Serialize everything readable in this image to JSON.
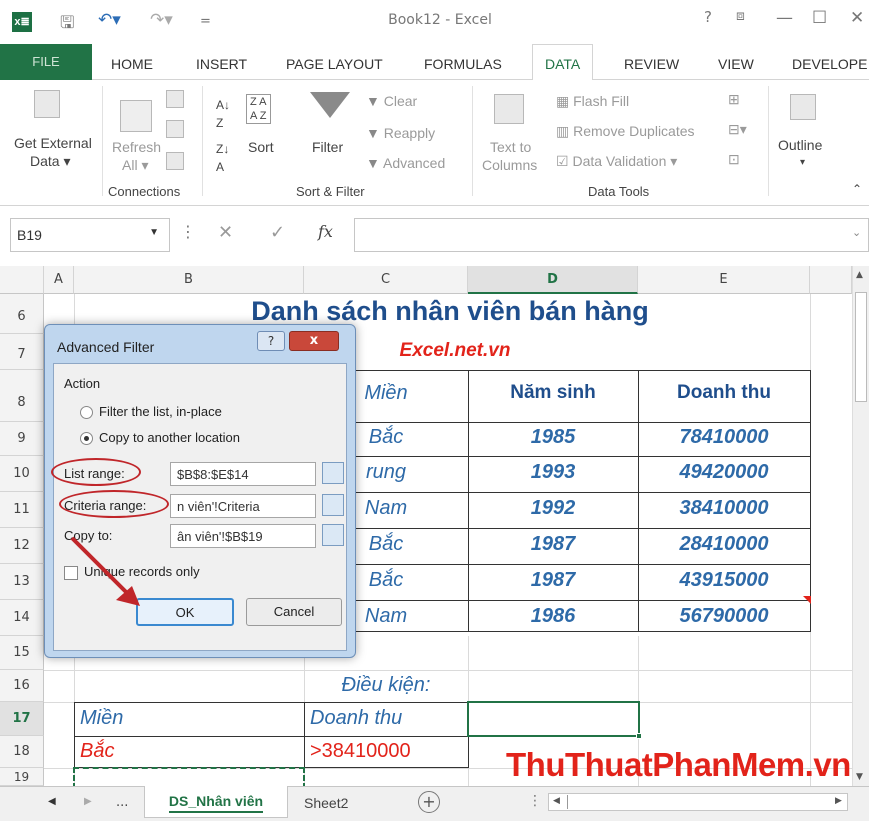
{
  "window": {
    "title": "Book12 - Excel"
  },
  "tabs": [
    "FILE",
    "HOME",
    "INSERT",
    "PAGE LAYOUT",
    "FORMULAS",
    "DATA",
    "REVIEW",
    "VIEW",
    "DEVELOPE"
  ],
  "ribbon": {
    "get_external_1": "Get External",
    "get_external_2": "Data",
    "refresh_1": "Refresh",
    "refresh_2": "All",
    "connections_label": "Connections",
    "filter": "Filter",
    "sort": "Sort",
    "clear": "Clear",
    "reapply": "Reapply",
    "advanced": "Advanced",
    "sort_filter_label": "Sort & Filter",
    "text_to_1": "Text to",
    "text_to_2": "Columns",
    "flash_fill": "Flash Fill",
    "remove_duplicates": "Remove Duplicates",
    "data_validation": "Data Validation",
    "data_tools_label": "Data Tools",
    "outline": "Outline"
  },
  "formula_bar": {
    "name_box": "B19",
    "fx": "fx",
    "value": ""
  },
  "columns": [
    "A",
    "B",
    "C",
    "D",
    "E"
  ],
  "rows": [
    "6",
    "7",
    "8",
    "9",
    "10",
    "11",
    "12",
    "13",
    "14",
    "15",
    "16",
    "17",
    "18",
    "19"
  ],
  "sheet": {
    "title": "Danh sách nhân viên bán hàng",
    "subtitle": "Excel.net.vn",
    "headers": {
      "c": "Miền",
      "d": "Năm sinh",
      "e": "Doanh thu"
    },
    "data": [
      {
        "c": "Bắc",
        "d": "1985",
        "e": "78410000"
      },
      {
        "c": "rung",
        "d": "1993",
        "e": "49420000"
      },
      {
        "c": "Nam",
        "d": "1992",
        "e": "38410000"
      },
      {
        "c": "Bắc",
        "d": "1987",
        "e": "28410000"
      },
      {
        "c": "Bắc",
        "d": "1987",
        "e": "43915000"
      },
      {
        "c": "Nam",
        "d": "1986",
        "e": "56790000"
      }
    ],
    "criteria_title": "Điều kiện:",
    "criteria_headers": {
      "b": "Miền",
      "c": "Doanh thu"
    },
    "criteria_values": {
      "b": "Bắc",
      "c": ">38410000"
    }
  },
  "dialog": {
    "title": "Advanced Filter",
    "help": "?",
    "close": "x",
    "action_label": "Action",
    "opt_inplace": "Filter the list, in-place",
    "opt_copy": "Copy to another location",
    "list_range_label": "List range:",
    "list_range_value": "$B$8:$E$14",
    "criteria_range_label": "Criteria range:",
    "criteria_range_value": "n viên'!Criteria",
    "copy_to_label": "Copy to:",
    "copy_to_value": "ân viên'!$B$19",
    "unique_label": "Unique records only",
    "ok": "OK",
    "cancel": "Cancel"
  },
  "sheet_tabs": {
    "ellipsis": "...",
    "active": "DS_Nhân viên",
    "other": "Sheet2"
  },
  "watermark": "ThuThuatPhanMem.vn",
  "colors": {
    "excel_green": "#217346",
    "cell_blue": "#2e6aa8",
    "criteria_red": "#e2231a",
    "highlight_red": "#c0262a"
  }
}
